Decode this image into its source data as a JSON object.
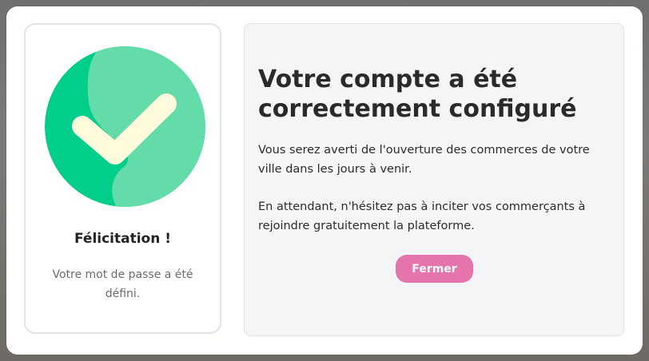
{
  "success_card": {
    "icon": "check-circle-icon",
    "title": "Félicitation !",
    "subtitle": "Votre mot de passe a été défini."
  },
  "info_panel": {
    "title": "Votre compte a été correctement configuré",
    "paragraph_1": "Vous serez averti de l'ouverture des commerces de votre ville dans les jours à venir.",
    "paragraph_2": "En attendant, n'hésitez pas à inciter vos commerçants à rejoindre gratuitement la plateforme.",
    "close_label": "Fermer"
  },
  "colors": {
    "check_green_dark": "#00ce8a",
    "check_green_light": "#63dcaa",
    "check_mark": "#fffbdc",
    "button_pink": "#e574ad"
  }
}
